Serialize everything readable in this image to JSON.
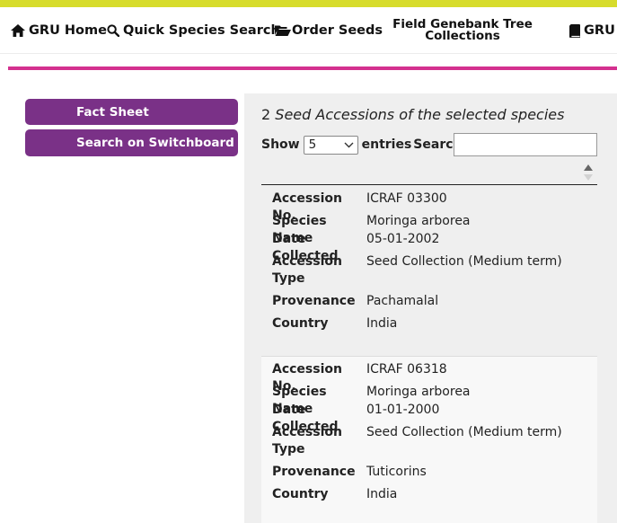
{
  "nav": {
    "items": [
      {
        "label": "GRU Home",
        "icon": "home-icon"
      },
      {
        "label": "Quick Species Search",
        "icon": "search-icon"
      },
      {
        "label": "Order Seeds",
        "icon": "folder-open-icon"
      },
      {
        "label_line1": "Field Genebank Tree",
        "label_line2": "Collections"
      },
      {
        "label": "GRU I",
        "icon": "book-icon"
      }
    ],
    "colors": {
      "top_stripe": "#d7dc2c",
      "magenta_bar": "#d4318f"
    }
  },
  "sidebar": {
    "buttons": [
      {
        "label": "Fact Sheet"
      },
      {
        "label": "Search on Switchboard"
      }
    ],
    "button_color": "#7a3187"
  },
  "panel": {
    "title_count": "2",
    "title_text": "Seed Accessions of the selected species",
    "show_label": "Show",
    "page_size": "5",
    "entries_label": "entries",
    "search_label": "Search:",
    "search_value": "",
    "records": [
      {
        "labels": {
          "accession": "Accession No.",
          "species": "Species Name",
          "date": "Date Collected",
          "type_line1": "Accession",
          "type_line2": "Type",
          "provenance": "Provenance",
          "country": "Country"
        },
        "accession": "ICRAF 03300",
        "species": "Moringa arborea",
        "date": "05-01-2002",
        "type": "Seed Collection (Medium term)",
        "provenance": "Pachamalal",
        "country": "India"
      },
      {
        "labels": {
          "accession": "Accession No.",
          "species": "Species Name",
          "date": "Date Collected",
          "type_line1": "Accession",
          "type_line2": "Type",
          "provenance": "Provenance",
          "country": "Country"
        },
        "accession": "ICRAF 06318",
        "species": "Moringa arborea",
        "date": "01-01-2000",
        "type": "Seed Collection (Medium term)",
        "provenance": "Tuticorins",
        "country": "India"
      }
    ]
  }
}
